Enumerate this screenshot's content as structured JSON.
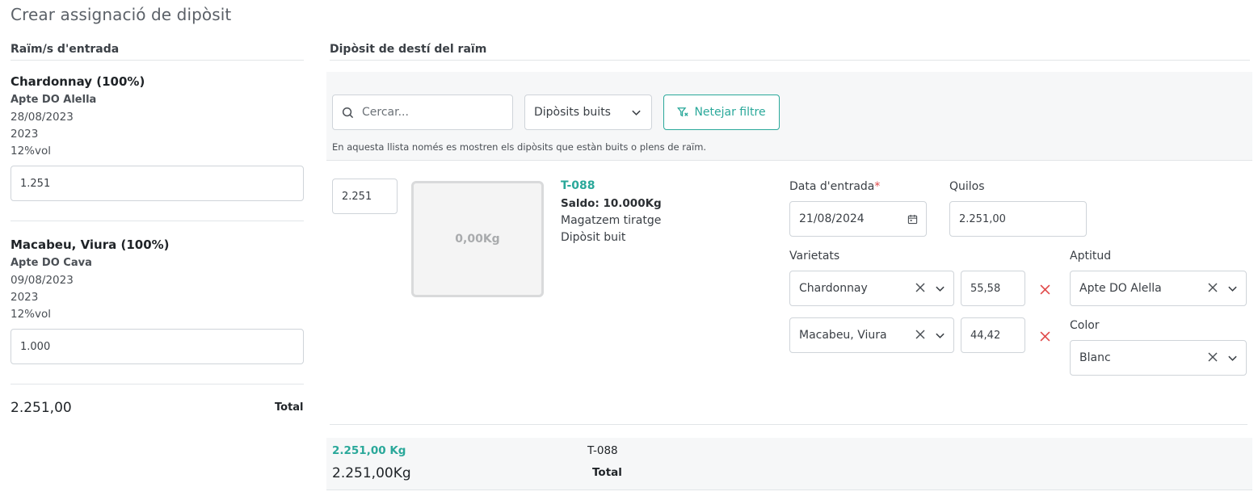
{
  "page": {
    "title": "Crear assignació de dipòsit"
  },
  "left": {
    "section_title": "Raïm/s d'entrada",
    "grapes": [
      {
        "name": "Chardonnay (100%)",
        "aptitude": "Apte DO Alella",
        "date": "28/08/2023",
        "year": "2023",
        "vol": "12%vol",
        "quantity": "1.251"
      },
      {
        "name": "Macabeu, Viura (100%)",
        "aptitude": "Apte DO Cava",
        "date": "09/08/2023",
        "year": "2023",
        "vol": "12%vol",
        "quantity": "1.000"
      }
    ],
    "total_value": "2.251,00",
    "total_label": "Total"
  },
  "right": {
    "section_title": "Dipòsit de destí del raïm",
    "search": {
      "placeholder": "Cercar..."
    },
    "filter_select": {
      "value": "Dipòsits buits"
    },
    "clear_filter_label": "Netejar filtre",
    "note": "En aquesta llista només es mostren els dipòsits que estàn buits o plens de raïm.",
    "tank": {
      "assigned_qty": "2.251",
      "fill_label": "0,00Kg",
      "code": "T-088",
      "saldo": "Saldo: 10.000Kg",
      "location": "Magatzem tiratge",
      "status": "Dipòsit buit"
    },
    "form": {
      "entry_date_label": "Data d'entrada",
      "required_mark": "*",
      "entry_date_value": "21/08/2024",
      "kilos_label": "Quilos",
      "kilos_value": "2.251,00",
      "varieties_label": "Varietats",
      "varieties": [
        {
          "name": "Chardonnay",
          "percent": "55,58"
        },
        {
          "name": "Macabeu, Viura",
          "percent": "44,42"
        }
      ],
      "aptitude_label": "Aptitud",
      "aptitude_value": "Apte DO Alella",
      "color_label": "Color",
      "color_value": "Blanc"
    },
    "summary": {
      "kg_green": "2.251,00 Kg",
      "tank_code": "T-088",
      "kg_total": "2.251,00Kg",
      "total_label": "Total"
    }
  },
  "colors": {
    "accent": "#2aa89a",
    "danger": "#e04848",
    "band": "#f6f7f8"
  }
}
